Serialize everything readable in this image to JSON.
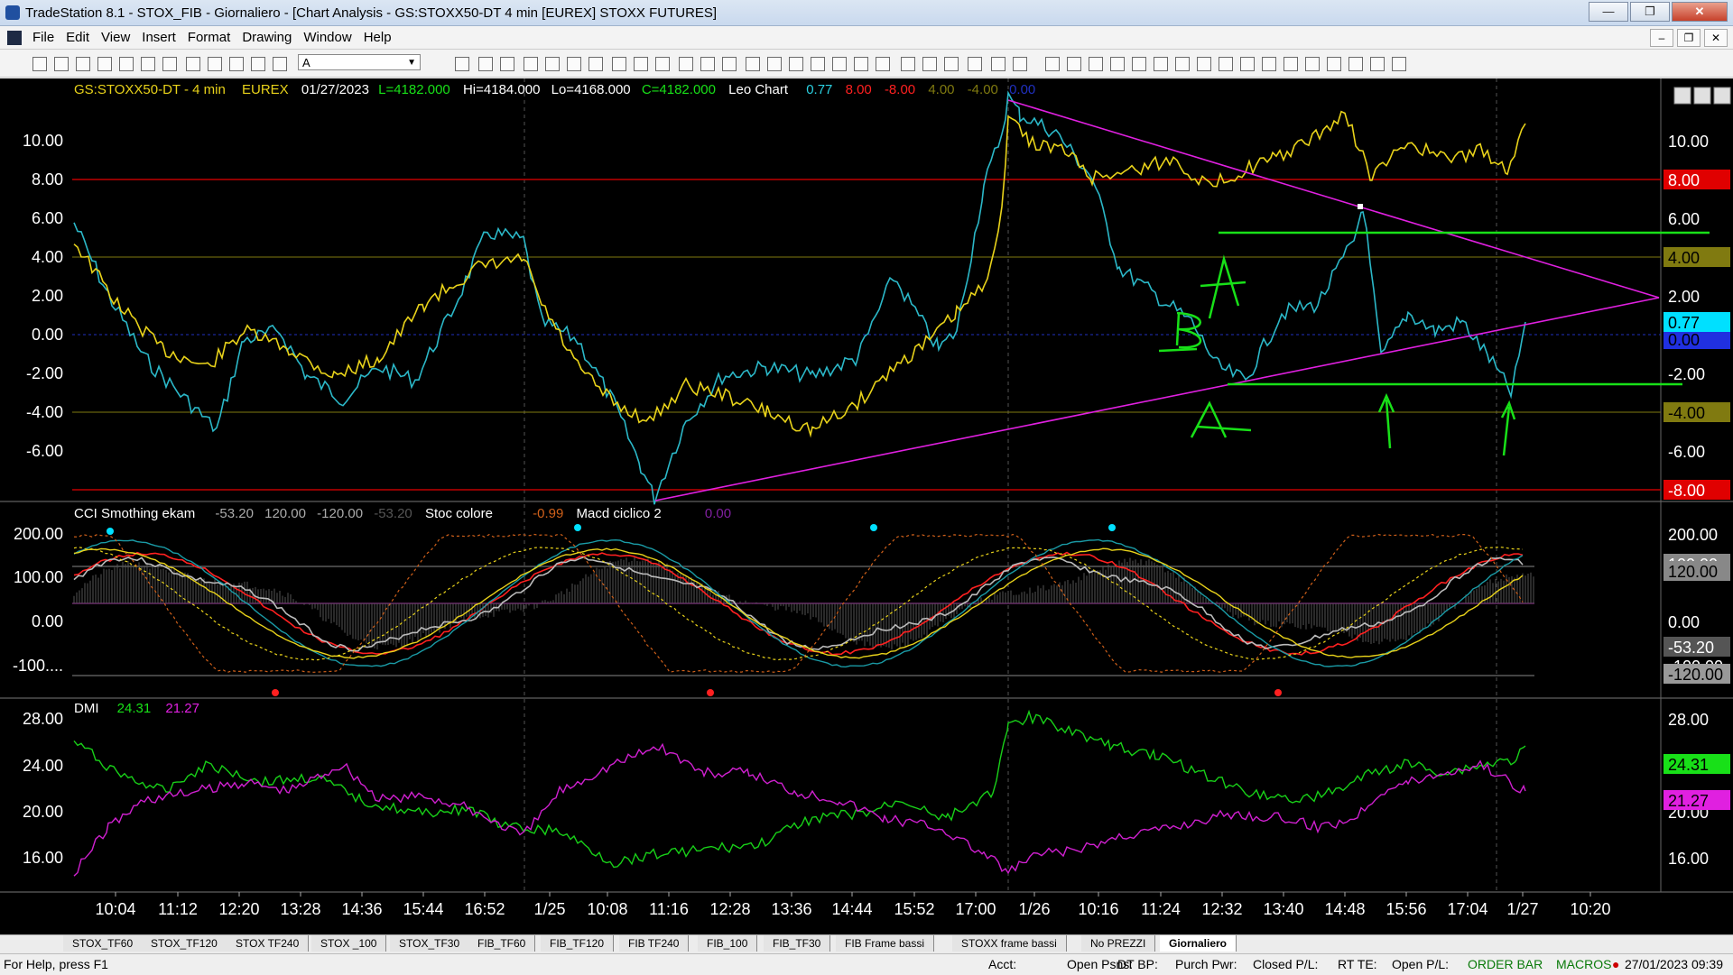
{
  "window": {
    "title": "TradeStation 8.1 - STOX_FIB - Giornaliero - [Chart Analysis - GS:STOXX50-DT  4 min  [EUREX] STOXX FUTURES]"
  },
  "menu": [
    "File",
    "Edit",
    "View",
    "Insert",
    "Format",
    "Drawing",
    "Window",
    "Help"
  ],
  "toolbar": {
    "font_value": "A"
  },
  "chart": {
    "header": {
      "symbol": "GS:STOXX50-DT - 4 min",
      "exchange": "EUREX",
      "date": "01/27/2023",
      "last": "L=4182.000",
      "high": "Hi=4184.000",
      "low": "Lo=4168.000",
      "close": "C=4182.000",
      "study": "Leo Chart",
      "v1": "0.77",
      "v2": "8.00",
      "v3": "-8.00",
      "v4": "4.00",
      "v5": "-4.00",
      "v6": "0.00"
    },
    "panel1_ticks": [
      "10.00",
      "8.00",
      "6.00",
      "4.00",
      "2.00",
      "0.00",
      "-2.00",
      "-4.00",
      "-6.00"
    ],
    "panel1_right_labels": [
      "10.00",
      "8.00",
      "6.00",
      "4.00",
      "2.00",
      "0.77",
      "0.00",
      "-2.00",
      "-4.00",
      "-6.00",
      "-8.00"
    ],
    "panel2_header": {
      "cci": "CCI Smothing ekam",
      "cci_v1": "-53.20",
      "cci_v2": "120.00",
      "cci_v3": "-120.00",
      "cci_v4": "-53.20",
      "stoc": "Stoc colore",
      "stoc_v": "-0.99",
      "macd": "Macd ciclico 2",
      "macd_v": "0.00"
    },
    "panel2_ticks": [
      "200.00",
      "100.00",
      "0.00",
      "-100...."
    ],
    "panel2_right_labels": [
      "200.00",
      "120.00",
      "100.00",
      "0.00",
      "-53.20",
      "-100.00",
      "-120.00"
    ],
    "panel3_header": {
      "dmi": "DMI",
      "v1": "24.31",
      "v2": "21.27"
    },
    "panel3_ticks": [
      "28.00",
      "24.00",
      "20.00",
      "16.00"
    ],
    "panel3_right_labels": [
      "28.00",
      "24.31",
      "21.27",
      "20.00",
      "16.00"
    ],
    "time_labels": [
      "10:04",
      "11:12",
      "12:20",
      "13:28",
      "14:36",
      "15:44",
      "16:52",
      "1/25",
      "10:08",
      "11:16",
      "12:28",
      "13:36",
      "14:44",
      "15:52",
      "17:00",
      "1/26",
      "10:16",
      "11:24",
      "12:32",
      "13:40",
      "14:48",
      "15:56",
      "17:04",
      "1/27",
      "10:20"
    ],
    "annotations": {
      "a": "A",
      "b": "B"
    }
  },
  "tabs": [
    "STOX_TF60",
    "STOX_TF120",
    "STOX TF240",
    "STOX _100",
    "STOX_TF30",
    "FIB_TF60",
    "FIB_TF120",
    "FIB TF240",
    "FIB_100",
    "FIB_TF30",
    "FIB Frame bassi",
    "STOXX frame bassi",
    "No PREZZI",
    "Giornaliero"
  ],
  "status": {
    "help": "For Help, press F1",
    "acct": "Acct:",
    "open_psns": "Open Psns:",
    "dt_bp": "DT BP:",
    "purch_pwr": "Purch Pwr:",
    "closed_pl": "Closed P/L:",
    "rt_te": "RT TE:",
    "open_pl": "Open P/L:",
    "order_bar": "ORDER BAR",
    "macros": "MACROS",
    "datetime": "27/01/2023 09:39"
  },
  "colors": {
    "yellow": "#e8d21a",
    "cyan": "#2bb8c8",
    "magenta": "#e020e0",
    "green": "#18e018",
    "red": "#c00000",
    "olive": "#807a10"
  }
}
